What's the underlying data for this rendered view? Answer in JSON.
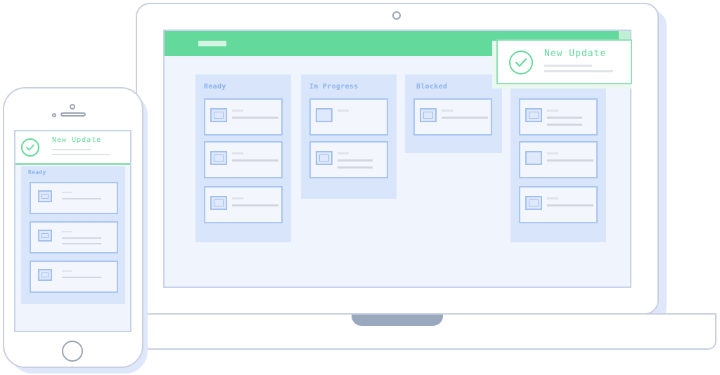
{
  "laptop": {
    "columns": [
      {
        "title": "Ready"
      },
      {
        "title": "In Progress"
      },
      {
        "title": "Blocked"
      },
      {
        "title": ""
      }
    ],
    "notification": {
      "title": "New Update",
      "icon": "check-circle-icon"
    }
  },
  "phone": {
    "notification": {
      "title": "New Update",
      "icon": "check-circle-icon"
    },
    "column_title": "Ready"
  },
  "colors": {
    "accent_green": "#63d99b",
    "card_border_blue": "#a8c6f2",
    "column_blue": "#d8e5fa",
    "screen_bg": "#f0f5fd"
  }
}
